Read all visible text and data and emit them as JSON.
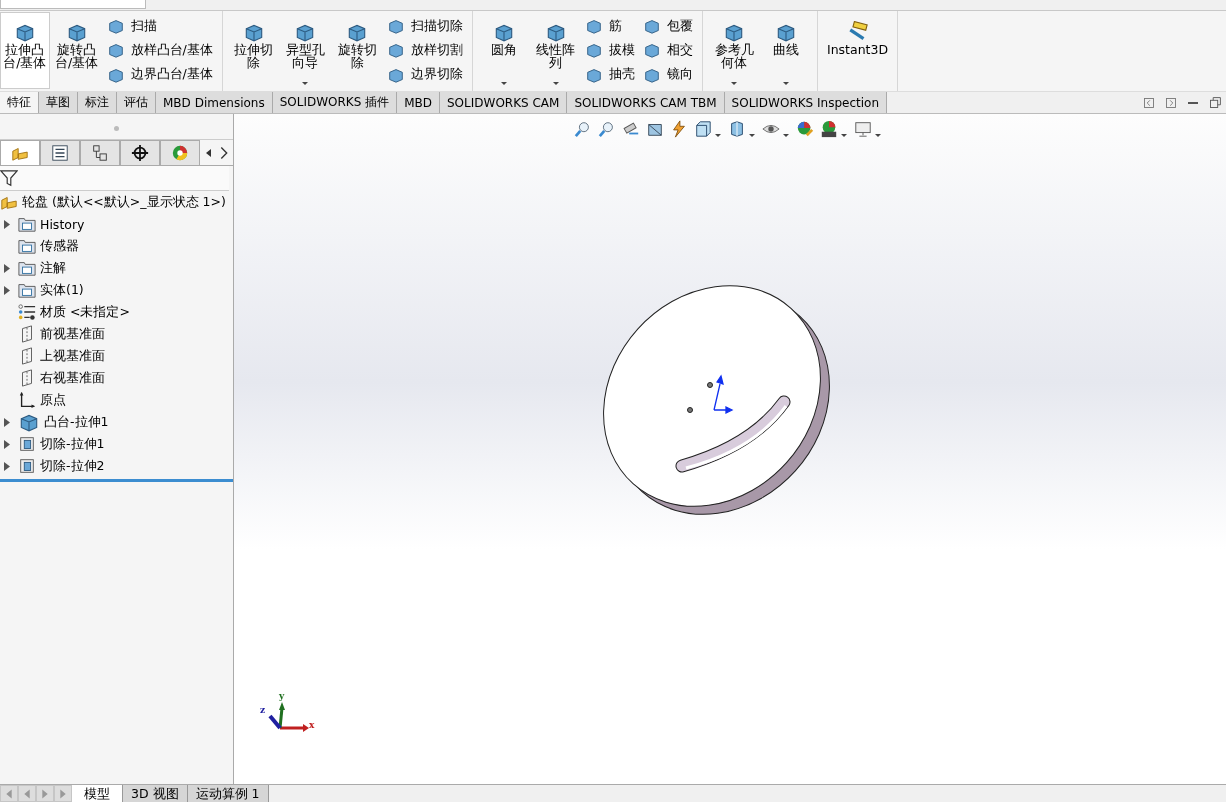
{
  "ribbon": {
    "groups": [
      {
        "items": [
          {
            "kind": "large",
            "label": "拉伸凸台/基体",
            "selected": true,
            "dropdown": false
          },
          {
            "kind": "large",
            "label": "旋转凸台/基体",
            "selected": false,
            "dropdown": false
          },
          {
            "kind": "column",
            "items": [
              {
                "label": "扫描"
              },
              {
                "label": "放样凸台/基体"
              },
              {
                "label": "边界凸台/基体"
              }
            ]
          }
        ]
      },
      {
        "items": [
          {
            "kind": "large",
            "label": "拉伸切除",
            "selected": false,
            "dropdown": false
          },
          {
            "kind": "large",
            "label": "异型孔向导",
            "selected": false,
            "dropdown": true
          },
          {
            "kind": "large",
            "label": "旋转切除",
            "selected": false,
            "dropdown": false
          },
          {
            "kind": "column",
            "items": [
              {
                "label": "扫描切除"
              },
              {
                "label": "放样切割"
              },
              {
                "label": "边界切除"
              }
            ]
          }
        ]
      },
      {
        "items": [
          {
            "kind": "large",
            "label": "圆角",
            "selected": false,
            "dropdown": true
          },
          {
            "kind": "large",
            "label": "线性阵列",
            "selected": false,
            "dropdown": true
          },
          {
            "kind": "column",
            "items": [
              {
                "label": "筋"
              },
              {
                "label": "拔模"
              },
              {
                "label": "抽壳"
              }
            ]
          },
          {
            "kind": "column",
            "items": [
              {
                "label": "包覆"
              },
              {
                "label": "相交"
              },
              {
                "label": "镜向"
              }
            ]
          }
        ]
      },
      {
        "items": [
          {
            "kind": "large",
            "label": "参考几何体",
            "selected": false,
            "dropdown": true
          },
          {
            "kind": "large",
            "label": "曲线",
            "selected": false,
            "dropdown": true
          }
        ]
      },
      {
        "items": [
          {
            "kind": "large",
            "label": "Instant3D",
            "selected": false,
            "dropdown": false
          }
        ]
      }
    ]
  },
  "tabs": [
    {
      "label": "特征",
      "selected": true
    },
    {
      "label": "草图",
      "selected": false
    },
    {
      "label": "标注",
      "selected": false
    },
    {
      "label": "评估",
      "selected": false
    },
    {
      "label": "MBD Dimensions",
      "selected": false
    },
    {
      "label": "SOLIDWORKS 插件",
      "selected": false
    },
    {
      "label": "MBD",
      "selected": false
    },
    {
      "label": "SOLIDWORKS CAM",
      "selected": false
    },
    {
      "label": "SOLIDWORKS CAM TBM",
      "selected": false
    },
    {
      "label": "SOLIDWORKS Inspection",
      "selected": false
    }
  ],
  "panel_tabs": [
    {
      "kind": "tree",
      "selected": true
    },
    {
      "kind": "property",
      "selected": false
    },
    {
      "kind": "config",
      "selected": false
    },
    {
      "kind": "dim",
      "selected": false
    },
    {
      "kind": "appearance",
      "selected": false
    }
  ],
  "tree": {
    "root": "轮盘",
    "root_config": "(默认<<默认>_显示状态 1>)",
    "children": [
      {
        "label": "History",
        "kind": "folder",
        "expander": true
      },
      {
        "label": "传感器",
        "kind": "folder",
        "expander": false
      },
      {
        "label": "注解",
        "kind": "folder",
        "expander": true
      },
      {
        "label": "实体(1)",
        "kind": "folder",
        "expander": true
      },
      {
        "label": "材质 <未指定>",
        "kind": "material",
        "expander": false
      },
      {
        "label": "前视基准面",
        "kind": "plane",
        "expander": false
      },
      {
        "label": "上视基准面",
        "kind": "plane",
        "expander": false
      },
      {
        "label": "右视基准面",
        "kind": "plane",
        "expander": false
      },
      {
        "label": "原点",
        "kind": "origin",
        "expander": false
      },
      {
        "label": "凸台-拉伸1",
        "kind": "boss",
        "expander": true
      },
      {
        "label": "切除-拉伸1",
        "kind": "cut",
        "expander": true
      },
      {
        "label": "切除-拉伸2",
        "kind": "cut",
        "expander": true
      }
    ]
  },
  "triad": {
    "labels": [
      "x",
      "y",
      "z"
    ]
  },
  "bottom_tabs": [
    {
      "label": "模型",
      "selected": true
    },
    {
      "label": "3D 视图",
      "selected": false
    },
    {
      "label": "运动算例 1",
      "selected": false
    }
  ]
}
